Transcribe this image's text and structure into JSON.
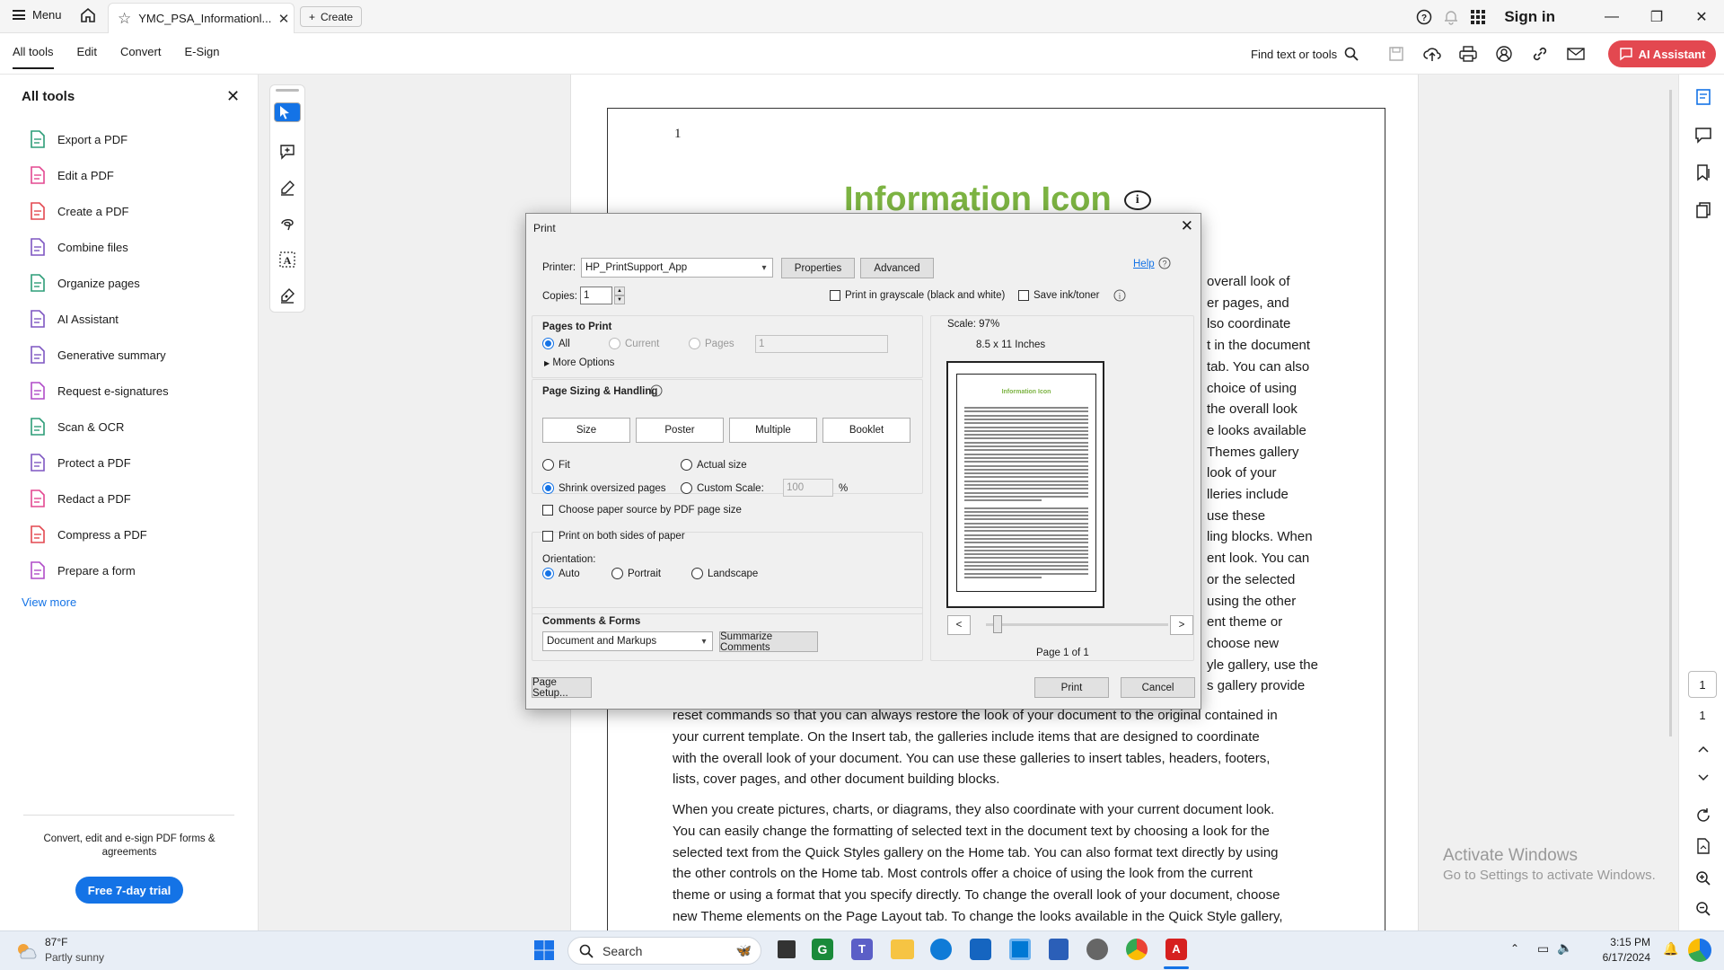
{
  "topbar": {
    "menu_label": "Menu",
    "tab_title": "YMC_PSA_Informationl...",
    "create_label": "Create",
    "signin_label": "Sign in"
  },
  "toolbar": {
    "tabs": [
      "All tools",
      "Edit",
      "Convert",
      "E-Sign"
    ],
    "find_label": "Find text or tools",
    "ai_label": "AI Assistant"
  },
  "left_panel": {
    "title": "All tools",
    "items": [
      {
        "label": "Export a PDF",
        "icon": "export-pdf-icon",
        "color": "#2d9d78"
      },
      {
        "label": "Edit a PDF",
        "icon": "edit-pdf-icon",
        "color": "#e34891"
      },
      {
        "label": "Create a PDF",
        "icon": "create-pdf-icon",
        "color": "#e34850"
      },
      {
        "label": "Combine files",
        "icon": "combine-files-icon",
        "color": "#7e57c2"
      },
      {
        "label": "Organize pages",
        "icon": "organize-pages-icon",
        "color": "#2d9d78"
      },
      {
        "label": "AI Assistant",
        "icon": "ai-assistant-icon",
        "color": "#7e57c2"
      },
      {
        "label": "Generative summary",
        "icon": "generative-summary-icon",
        "color": "#7e57c2"
      },
      {
        "label": "Request e-signatures",
        "icon": "request-esign-icon",
        "color": "#b04cc8"
      },
      {
        "label": "Scan & OCR",
        "icon": "scan-ocr-icon",
        "color": "#2d9d78"
      },
      {
        "label": "Protect a PDF",
        "icon": "protect-pdf-icon",
        "color": "#7e57c2"
      },
      {
        "label": "Redact a PDF",
        "icon": "redact-pdf-icon",
        "color": "#e34891"
      },
      {
        "label": "Compress a PDF",
        "icon": "compress-pdf-icon",
        "color": "#e34850"
      },
      {
        "label": "Prepare a form",
        "icon": "prepare-form-icon",
        "color": "#b04cc8"
      }
    ],
    "view_more": "View more",
    "promo": "Convert, edit and e-sign PDF forms & agreements",
    "trial_label": "Free 7-day trial"
  },
  "document": {
    "page_number": "1",
    "title": "Information Icon",
    "info_glyph": "i",
    "peek_lines": [
      "overall look of",
      "er pages, and",
      "lso coordinate",
      "t in the document",
      "tab. You can also",
      "choice of using",
      "the overall look",
      "e looks available",
      "Themes gallery",
      "look of your",
      "lleries include",
      "use these",
      "ling blocks. When",
      "ent look. You can",
      "or the selected",
      "using the other",
      "ent theme or",
      "choose new",
      "yle gallery, use the",
      "s gallery provide"
    ],
    "paragraph1": [
      "reset commands so that you can always restore the look of your document to the original contained in",
      "your current template. On the Insert tab, the galleries include items that are designed to coordinate",
      "with the overall look of your document. You can use these galleries to insert tables, headers, footers,",
      "lists, cover pages, and other document building blocks."
    ],
    "paragraph2": [
      "When you create pictures, charts, or diagrams, they also coordinate with your current document look.",
      "You can easily change the formatting of selected text in the document text by choosing a look for the",
      "selected text from the Quick Styles gallery on the Home tab. You can also format text directly by using",
      "the other controls on the Home tab. Most controls offer a choice of using the look from the current",
      "theme or using a format that you specify directly. To change the overall look of your document, choose",
      "new Theme elements on the Page Layout tab. To change the looks available in the Quick Style gallery,"
    ]
  },
  "activate": {
    "line1": "Activate Windows",
    "line2": "Go to Settings to activate Windows."
  },
  "right_rail": {
    "current_page": "1",
    "total_pages": "1"
  },
  "print_dialog": {
    "title": "Print",
    "printer_label": "Printer:",
    "printer_value": "HP_PrintSupport_App",
    "properties_label": "Properties",
    "advanced_label": "Advanced",
    "help_label": "Help",
    "copies_label": "Copies:",
    "copies_value": "1",
    "grayscale_label": "Print in grayscale (black and white)",
    "save_ink_label": "Save ink/toner",
    "pages_section": "Pages to Print",
    "pages_all": "All",
    "pages_current": "Current",
    "pages_pages": "Pages",
    "pages_range_value": "1",
    "more_options": "More Options",
    "sizing_section": "Page Sizing & Handling",
    "sizing_tabs": [
      "Size",
      "Poster",
      "Multiple",
      "Booklet"
    ],
    "fit_label": "Fit",
    "actual_size_label": "Actual size",
    "shrink_label": "Shrink oversized pages",
    "custom_scale_label": "Custom Scale:",
    "custom_scale_value": "100",
    "percent": "%",
    "paper_source_label": "Choose paper source by PDF page size",
    "both_sides_label": "Print on both sides of paper",
    "orientation_label": "Orientation:",
    "orient_auto": "Auto",
    "orient_portrait": "Portrait",
    "orient_landscape": "Landscape",
    "comments_section": "Comments & Forms",
    "comments_value": "Document and Markups",
    "summarize_label": "Summarize Comments",
    "scale_text": "Scale:  97%",
    "paper_size": "8.5 x 11 Inches",
    "preview_title": "Information Icon",
    "prev_label": "<",
    "next_label": ">",
    "page_of": "Page 1 of 1",
    "page_setup_label": "Page Setup...",
    "print_label": "Print",
    "cancel_label": "Cancel"
  },
  "taskbar": {
    "temperature": "87°F",
    "weather": "Partly sunny",
    "search_placeholder": "Search",
    "time": "3:15 PM",
    "date": "6/17/2024"
  }
}
